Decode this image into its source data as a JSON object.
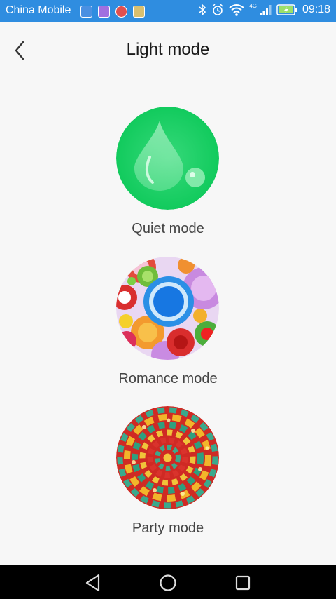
{
  "status_bar": {
    "carrier": "China Mobile",
    "network_type": "4G",
    "time": "09:18",
    "notification_icons": [
      "shield-icon",
      "image-icon",
      "settings-icon",
      "app-icon"
    ],
    "notification_colors": [
      "#4a90e2",
      "#a070e0",
      "#e05050",
      "#d8c070"
    ]
  },
  "header": {
    "title": "Light mode"
  },
  "modes": [
    {
      "label": "Quiet mode",
      "icon": "water-drop-icon"
    },
    {
      "label": "Romance mode",
      "icon": "colorful-circles-icon"
    },
    {
      "label": "Party mode",
      "icon": "mosaic-icon"
    }
  ],
  "colors": {
    "status_bar": "#2f8de0",
    "quiet_green": "#1fd06a",
    "background": "#f7f7f7"
  }
}
